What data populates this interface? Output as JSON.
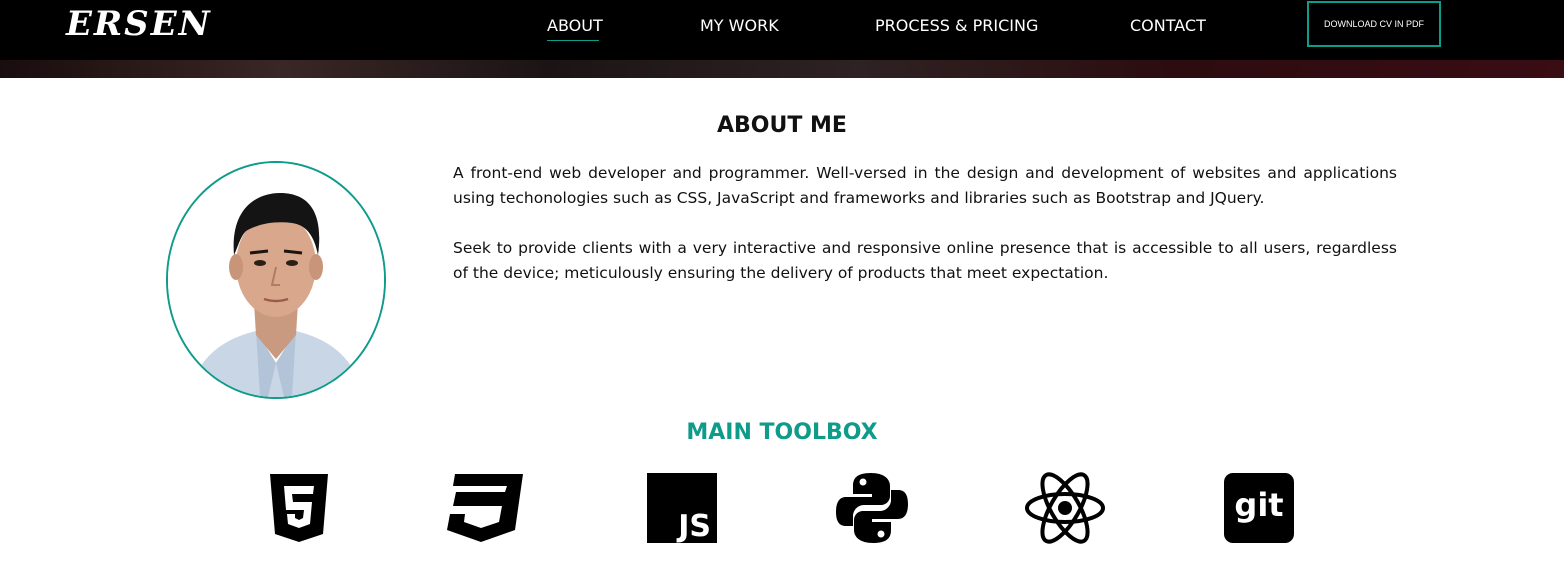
{
  "header": {
    "logo": "ERSEN",
    "nav": [
      {
        "label": "ABOUT"
      },
      {
        "label": "MY WORK"
      },
      {
        "label": "PROCESS & PRICING"
      },
      {
        "label": "CONTACT"
      }
    ],
    "cv_button": "DOWNLOAD CV IN PDF",
    "accent_color": "#0f9b8a"
  },
  "about": {
    "title": "ABOUT ME",
    "paragraphs": [
      "A front-end web developer and programmer. Well-versed in the design and development of websites and applications using techonologies such as CSS, JavaScript and frameworks and libraries such as Bootstrap and JQuery.",
      "Seek to provide clients with a very interactive and responsive online presence that is accessible to all users, regardless of the device; meticulously ensuring the delivery of products that meet expectation."
    ]
  },
  "toolbox": {
    "title": "MAIN TOOLBOX",
    "tools": [
      {
        "icon": "html5-icon"
      },
      {
        "icon": "css3-icon"
      },
      {
        "icon": "javascript-icon",
        "text": "JS"
      },
      {
        "icon": "python-icon"
      },
      {
        "icon": "react-icon"
      },
      {
        "icon": "git-icon",
        "text": "git"
      }
    ]
  }
}
